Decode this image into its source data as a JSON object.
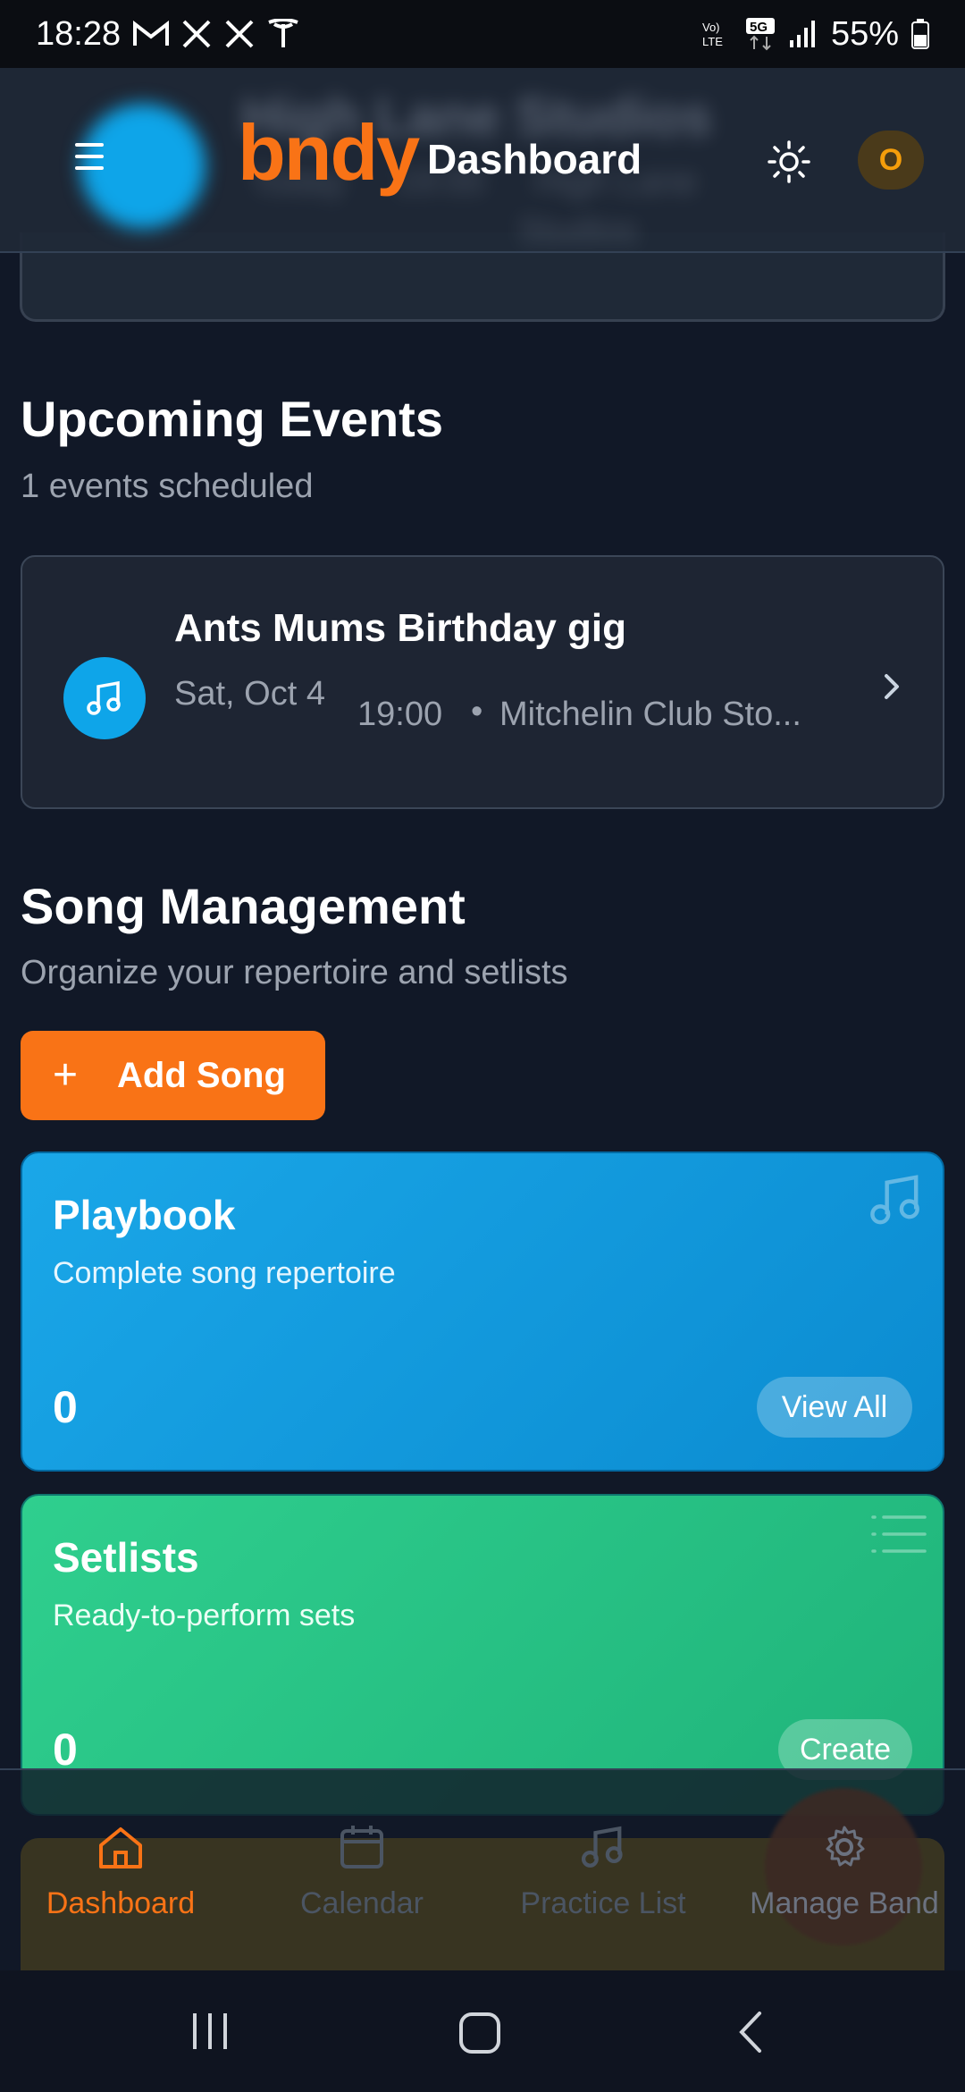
{
  "status_bar": {
    "time": "18:28",
    "left_icons": [
      "gmail-icon",
      "x-icon",
      "x-icon",
      "tesla-icon"
    ],
    "battery": "55%"
  },
  "header": {
    "logo": "bndy",
    "title": "Dashboard",
    "avatar_initial": "O",
    "blurred_background": {
      "title": "High Lane Studios",
      "line1": "Today",
      "line2": "19:00",
      "line3": "High Lane",
      "line4": "Studios"
    }
  },
  "upcoming": {
    "title": "Upcoming Events",
    "subtitle": "1 events scheduled",
    "event": {
      "name": "Ants Mums Birthday gig",
      "date": "Sat, Oct 4",
      "time": "19:00",
      "separator": "•",
      "location": "Mitchelin Club Sto..."
    }
  },
  "songs": {
    "title": "Song Management",
    "subtitle": "Organize your repertoire and setlists",
    "add_label": "Add Song",
    "playbook": {
      "title": "Playbook",
      "desc": "Complete song repertoire",
      "count": "0",
      "action": "View All"
    },
    "setlists": {
      "title": "Setlists",
      "desc": "Ready-to-perform sets",
      "count": "0",
      "action": "Create"
    }
  },
  "bottom_nav": {
    "items": [
      {
        "label": "Dashboard",
        "icon": "home-icon",
        "color": "#f97316"
      },
      {
        "label": "Calendar",
        "icon": "calendar-icon",
        "color": "#4b5563"
      },
      {
        "label": "Practice List",
        "icon": "music-note-icon",
        "color": "#4b5563"
      },
      {
        "label": "Manage Band",
        "icon": "gear-icon",
        "color": "#4b5563"
      }
    ]
  },
  "colors": {
    "accent": "#f97316",
    "background": "#111827",
    "playbook": "#0ea5e9",
    "setlists": "#22c55e"
  }
}
